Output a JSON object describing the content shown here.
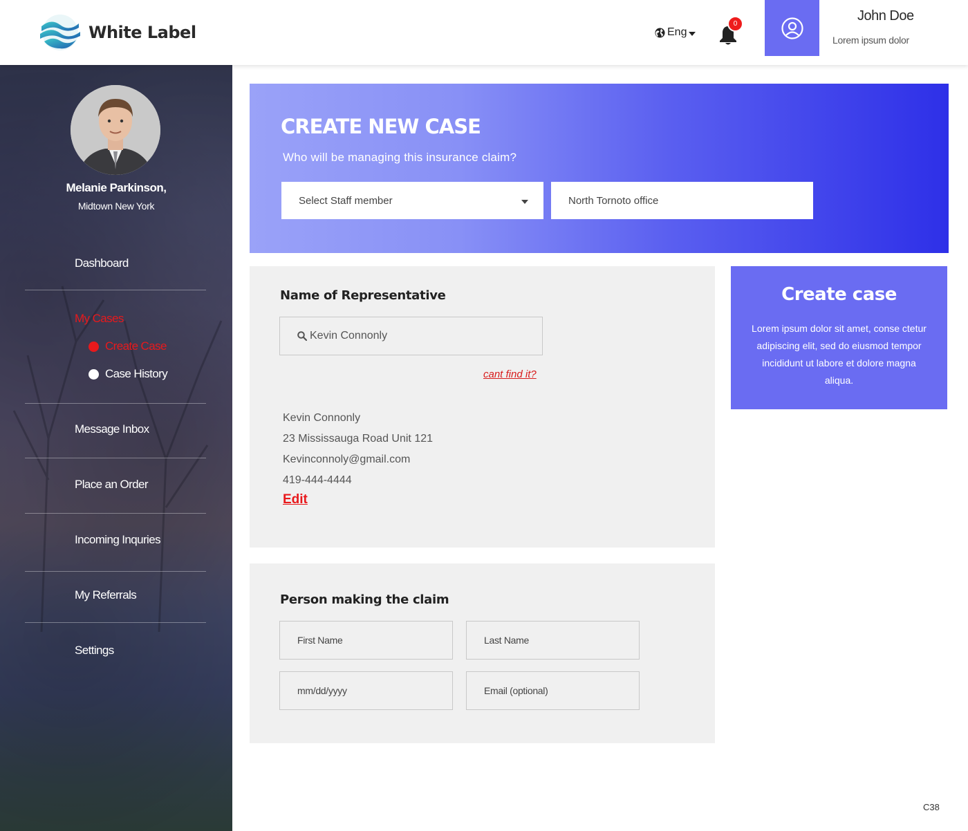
{
  "header": {
    "logo_text": "White Label",
    "language": "Eng",
    "notification_count": "0",
    "user_name": "John Doe",
    "user_subtitle": "Lorem ipsum dolor"
  },
  "sidebar": {
    "profile_name": "Melanie Parkinson,",
    "profile_location": "Midtown New York",
    "nav": {
      "dashboard": "Dashboard",
      "my_cases": "My Cases",
      "create_case": "Create Case",
      "case_history": "Case History",
      "message_inbox": "Message Inbox",
      "place_order": "Place an Order",
      "incoming_inquiries": "Incoming Inquries",
      "my_referrals": "My Referrals",
      "settings": "Settings"
    }
  },
  "hero": {
    "title": "CREATE NEW CASE",
    "subtitle": "Who will be managing this insurance claim?",
    "staff_select_value": "Select Staff member",
    "office_value": "North Tornoto office"
  },
  "representative": {
    "title": "Name of Representative",
    "search_value": "Kevin Connonly",
    "cant_find": "cant find it?",
    "name": "Kevin Connonly",
    "address": "23 Mississauga Road Unit 121",
    "email": "Kevinconnoly@gmail.com",
    "phone": "419-444-4444",
    "edit": "Edit"
  },
  "claimant": {
    "title": "Person making the claim",
    "first_name_placeholder": "First Name",
    "last_name_placeholder": "Last Name",
    "dob_placeholder": "mm/dd/yyyy",
    "email_placeholder": "Email (optional)"
  },
  "cta": {
    "title": "Create case",
    "body": "Lorem ipsum dolor sit amet, conse ctetur adipiscing elit, sed do eiusmod tempor incididunt ut labore et dolore magna aliqua."
  },
  "page_code": "C38",
  "colors": {
    "accent": "#6a6cf2",
    "active_red": "#e8191c",
    "hero_start": "#9aa2f8",
    "hero_end": "#2e30e8"
  },
  "icons": {
    "logo": "wave-logo-icon",
    "language": "globe-icon",
    "notifications": "bell-icon",
    "user": "user-circle-icon",
    "search": "search-icon"
  }
}
